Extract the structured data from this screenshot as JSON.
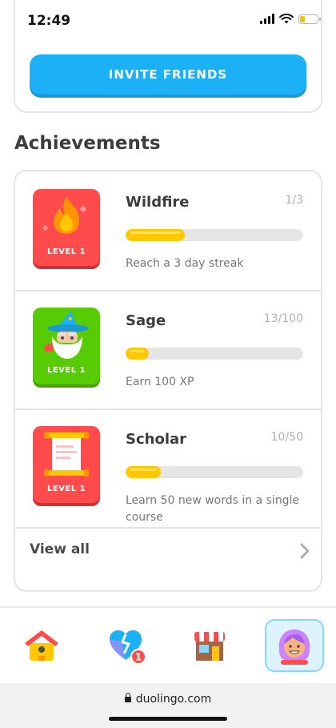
{
  "status_bar": {
    "time": "12:49"
  },
  "invite": {
    "button_label": "INVITE FRIENDS"
  },
  "achievements": {
    "title": "Achievements",
    "items": [
      {
        "name": "Wildfire",
        "progress_text": "1/3",
        "progress": 0.333,
        "description": "Reach a 3 day streak",
        "level_label": "LEVEL 1",
        "badge_color": "#ff4b4b",
        "icon": "flame-icon"
      },
      {
        "name": "Sage",
        "progress_text": "13/100",
        "progress": 0.13,
        "description": "Earn 100 XP",
        "level_label": "LEVEL 1",
        "badge_color": "#58cc02",
        "icon": "wizard-icon"
      },
      {
        "name": "Scholar",
        "progress_text": "10/50",
        "progress": 0.2,
        "description": "Learn 50 new words in a single course",
        "level_label": "LEVEL 1",
        "badge_color": "#ff4b4b",
        "icon": "scroll-icon"
      }
    ],
    "view_all_label": "View all"
  },
  "bottom_nav": {
    "items": [
      {
        "icon": "home-icon",
        "active": false
      },
      {
        "icon": "heart-badge-icon",
        "badge": "1",
        "active": false
      },
      {
        "icon": "shop-icon",
        "active": false
      },
      {
        "icon": "profile-avatar-icon",
        "active": true
      }
    ]
  },
  "browser": {
    "url": "duolingo.com"
  },
  "colors": {
    "accent_blue": "#1cb0f6",
    "progress_yellow": "#ffc800",
    "border_gray": "#e5e5e5"
  }
}
